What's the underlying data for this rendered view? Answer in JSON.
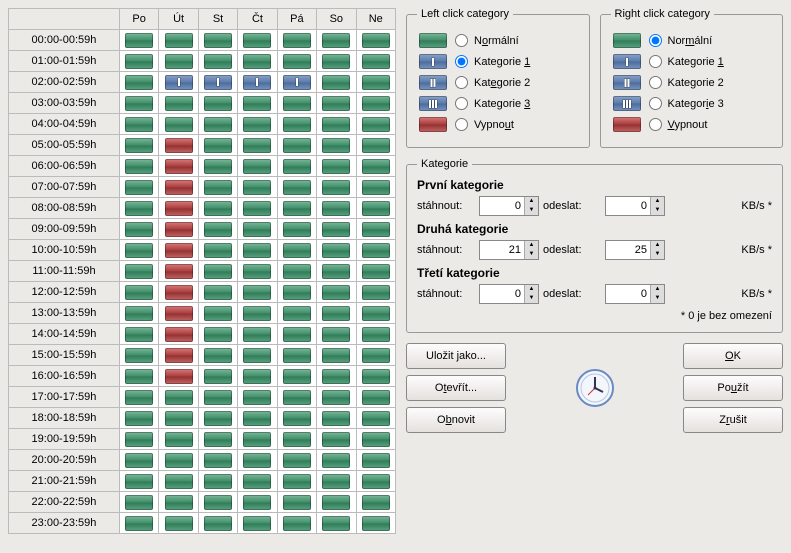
{
  "days": [
    "Po",
    "Út",
    "St",
    "Čt",
    "Pá",
    "So",
    "Ne"
  ],
  "hours": [
    "00:00-00:59h",
    "01:00-01:59h",
    "02:00-02:59h",
    "03:00-03:59h",
    "04:00-04:59h",
    "05:00-05:59h",
    "06:00-06:59h",
    "07:00-07:59h",
    "08:00-08:59h",
    "09:00-09:59h",
    "10:00-10:59h",
    "11:00-11:59h",
    "12:00-12:59h",
    "13:00-13:59h",
    "14:00-14:59h",
    "15:00-15:59h",
    "16:00-16:59h",
    "17:00-17:59h",
    "18:00-18:59h",
    "19:00-19:59h",
    "20:00-20:59h",
    "21:00-21:59h",
    "22:00-22:59h",
    "23:00-23:59h"
  ],
  "grid": [
    [
      "normal",
      "normal",
      "normal",
      "normal",
      "normal",
      "normal",
      "normal"
    ],
    [
      "normal",
      "normal",
      "normal",
      "normal",
      "normal",
      "normal",
      "normal"
    ],
    [
      "normal",
      "cat1",
      "cat1",
      "cat1",
      "cat1",
      "normal",
      "normal"
    ],
    [
      "normal",
      "normal",
      "normal",
      "normal",
      "normal",
      "normal",
      "normal"
    ],
    [
      "normal",
      "normal",
      "normal",
      "normal",
      "normal",
      "normal",
      "normal"
    ],
    [
      "normal",
      "off",
      "normal",
      "normal",
      "normal",
      "normal",
      "normal"
    ],
    [
      "normal",
      "off",
      "normal",
      "normal",
      "normal",
      "normal",
      "normal"
    ],
    [
      "normal",
      "off",
      "normal",
      "normal",
      "normal",
      "normal",
      "normal"
    ],
    [
      "normal",
      "off",
      "normal",
      "normal",
      "normal",
      "normal",
      "normal"
    ],
    [
      "normal",
      "off",
      "normal",
      "normal",
      "normal",
      "normal",
      "normal"
    ],
    [
      "normal",
      "off",
      "normal",
      "normal",
      "normal",
      "normal",
      "normal"
    ],
    [
      "normal",
      "off",
      "normal",
      "normal",
      "normal",
      "normal",
      "normal"
    ],
    [
      "normal",
      "off",
      "normal",
      "normal",
      "normal",
      "normal",
      "normal"
    ],
    [
      "normal",
      "off",
      "normal",
      "normal",
      "normal",
      "normal",
      "normal"
    ],
    [
      "normal",
      "off",
      "normal",
      "normal",
      "normal",
      "normal",
      "normal"
    ],
    [
      "normal",
      "off",
      "normal",
      "normal",
      "normal",
      "normal",
      "normal"
    ],
    [
      "normal",
      "off",
      "normal",
      "normal",
      "normal",
      "normal",
      "normal"
    ],
    [
      "normal",
      "normal",
      "normal",
      "normal",
      "normal",
      "normal",
      "normal"
    ],
    [
      "normal",
      "normal",
      "normal",
      "normal",
      "normal",
      "normal",
      "normal"
    ],
    [
      "normal",
      "normal",
      "normal",
      "normal",
      "normal",
      "normal",
      "normal"
    ],
    [
      "normal",
      "normal",
      "normal",
      "normal",
      "normal",
      "normal",
      "normal"
    ],
    [
      "normal",
      "normal",
      "normal",
      "normal",
      "normal",
      "normal",
      "normal"
    ],
    [
      "normal",
      "normal",
      "normal",
      "normal",
      "normal",
      "normal",
      "normal"
    ],
    [
      "normal",
      "normal",
      "normal",
      "normal",
      "normal",
      "normal",
      "normal"
    ]
  ],
  "leftClick": {
    "legend": "Left click category",
    "options": [
      {
        "kind": "normal",
        "label_pre": "N",
        "label_u": "o",
        "label_post": "rmální"
      },
      {
        "kind": "cat1",
        "label_pre": "Kategorie ",
        "label_u": "1",
        "label_post": ""
      },
      {
        "kind": "cat2",
        "label_pre": "Kat",
        "label_u": "e",
        "label_post": "gorie 2"
      },
      {
        "kind": "cat3",
        "label_pre": "Kategorie ",
        "label_u": "3",
        "label_post": ""
      },
      {
        "kind": "off",
        "label_pre": "Vypno",
        "label_u": "u",
        "label_post": "t"
      }
    ],
    "selected": "cat1"
  },
  "rightClick": {
    "legend": "Right click category",
    "options": [
      {
        "kind": "normal",
        "label_pre": "Nor",
        "label_u": "m",
        "label_post": "ální"
      },
      {
        "kind": "cat1",
        "label_pre": "Kategorie ",
        "label_u": "1",
        "label_post": ""
      },
      {
        "kind": "cat2",
        "label_pre": "Kate",
        "label_u": "g",
        "label_post": "orie 2"
      },
      {
        "kind": "cat3",
        "label_pre": "Kategor",
        "label_u": "i",
        "label_post": "e 3"
      },
      {
        "kind": "off",
        "label_pre": "",
        "label_u": "V",
        "label_post": "ypnout"
      }
    ],
    "selected": "normal"
  },
  "kategorie": {
    "legend": "Kategorie",
    "dl_label": "stáhnout:",
    "ul_label": "odeslat:",
    "unit": "KB/s *",
    "groups": [
      {
        "title": "První kategorie",
        "dl": 0,
        "ul": 0
      },
      {
        "title": "Druhá kategorie",
        "dl": 21,
        "ul": 25
      },
      {
        "title": "Třetí kategorie",
        "dl": 0,
        "ul": 0
      }
    ],
    "note": "* 0 je bez omezení"
  },
  "buttons": {
    "saveas": "Uložit jako...",
    "open_pre": "O",
    "open_u": "t",
    "open_post": "evřít...",
    "reset_pre": "O",
    "reset_u": "b",
    "reset_post": "novit",
    "ok_pre": "",
    "ok_u": "O",
    "ok_post": "K",
    "apply_pre": "Po",
    "apply_u": "u",
    "apply_post": "žít",
    "cancel_pre": "Z",
    "cancel_u": "r",
    "cancel_post": "ušit"
  }
}
